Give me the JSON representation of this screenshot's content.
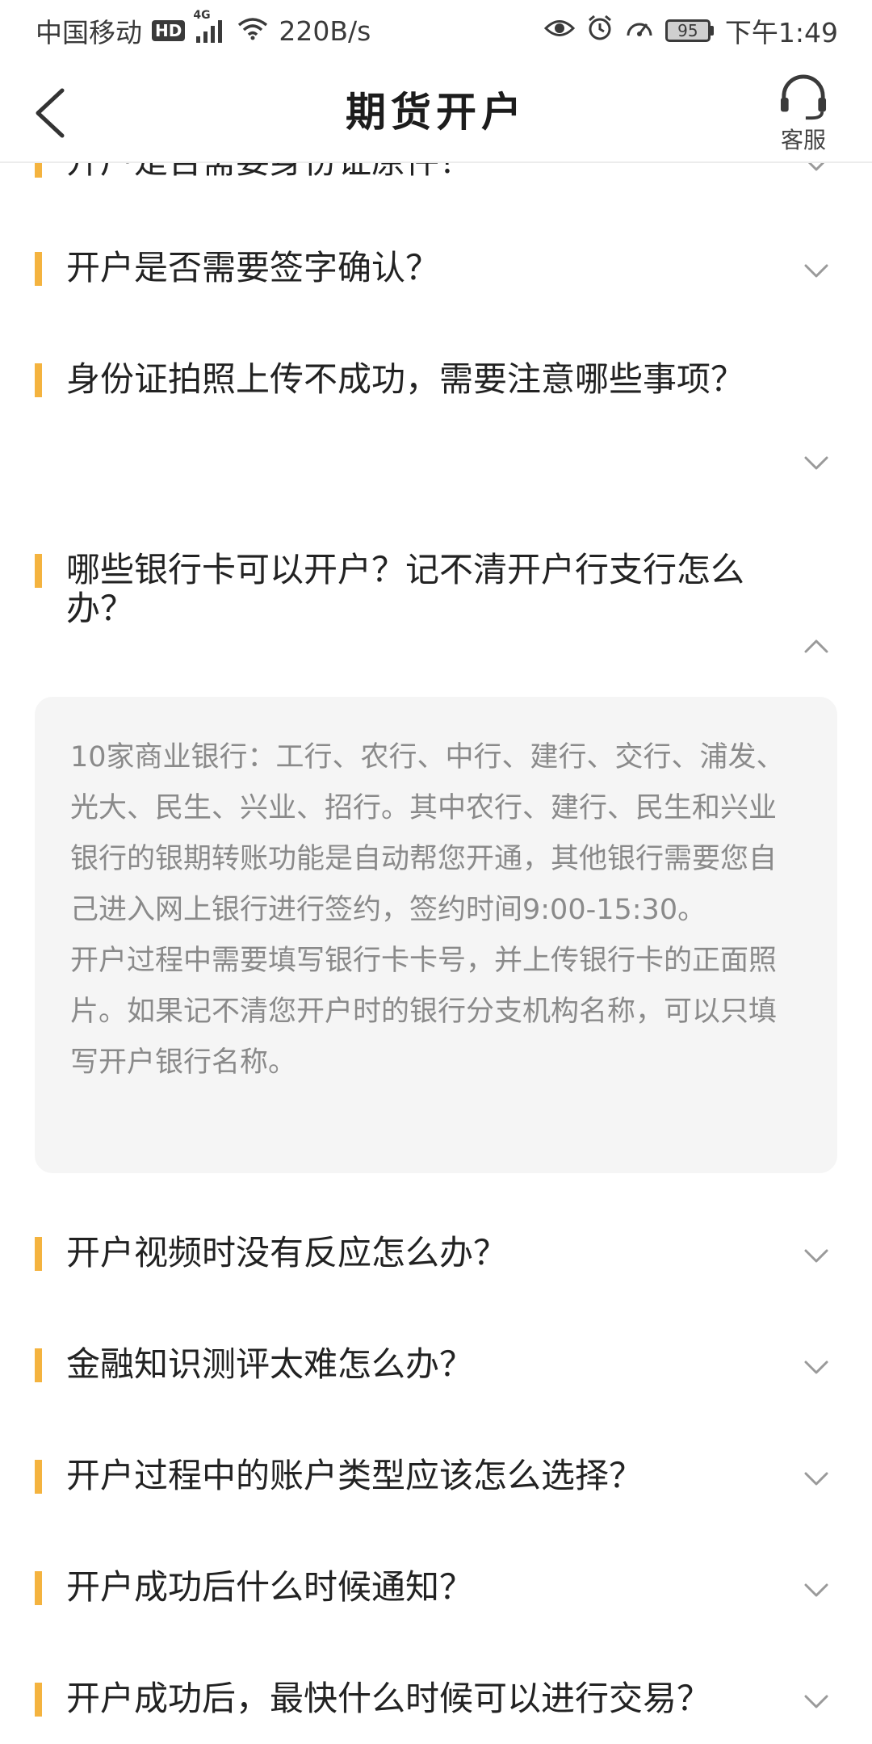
{
  "status_bar": {
    "carrier": "中国移动",
    "hd": "HD",
    "network": "4G",
    "speed": "220B/s",
    "battery": "95",
    "time": "下午1:49"
  },
  "header": {
    "title": "期货开户",
    "customer_service_label": "客服"
  },
  "colors": {
    "accent_bar": "#f4b33f",
    "answer_bg": "#f5f5f5",
    "answer_text": "#8a8a8a"
  },
  "faq": {
    "items": [
      {
        "question": "开户是否需要身份证原件？",
        "expanded": false
      },
      {
        "question": "开户是否需要签字确认？",
        "expanded": false
      },
      {
        "question": "身份证拍照上传不成功，需要注意哪些事项？",
        "expanded": false
      },
      {
        "question": "哪些银行卡可以开户？记不清开户行支行怎么办？",
        "expanded": true
      },
      {
        "question": "开户视频时没有反应怎么办？",
        "expanded": false
      },
      {
        "question": "金融知识测评太难怎么办？",
        "expanded": false
      },
      {
        "question": "开户过程中的账户类型应该怎么选择？",
        "expanded": false
      },
      {
        "question": "开户成功后什么时候通知？",
        "expanded": false
      },
      {
        "question": "开户成功后，最快什么时候可以进行交易？",
        "expanded": false
      }
    ],
    "answer": {
      "p1": "10家商业银行：工行、农行、中行、建行、交行、浦发、光大、民生、兴业、招行。其中农行、建行、民生和兴业银行的银期转账功能是自动帮您开通，其他银行需要您自己进入网上银行进行签约，签约时间9:00-15:30。",
      "p2": "开户过程中需要填写银行卡卡号，并上传银行卡的正面照片。如果记不清您开户时的银行分支机构名称，可以只填写开户银行名称。"
    }
  }
}
